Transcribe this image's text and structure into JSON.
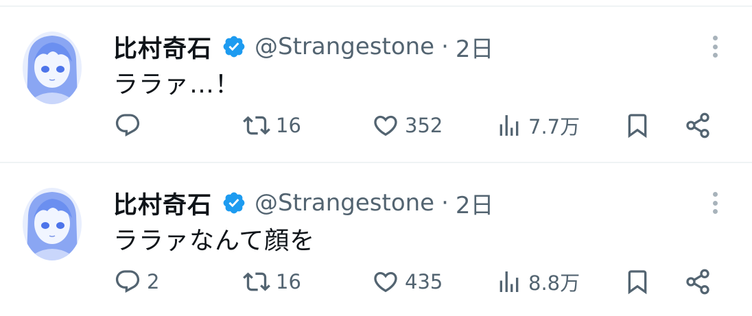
{
  "tweets": [
    {
      "name": "比村奇石",
      "handle": "@Strangestone",
      "separator": "·",
      "time": "2日",
      "text": "ララァ…！",
      "replies": "",
      "retweets": "16",
      "likes": "352",
      "views": "7.7万"
    },
    {
      "name": "比村奇石",
      "handle": "@Strangestone",
      "separator": "·",
      "time": "2日",
      "text": "ララァなんて顔を",
      "replies": "2",
      "retweets": "16",
      "likes": "435",
      "views": "8.8万"
    }
  ],
  "colors": {
    "text": "#0f1419",
    "muted": "#536471",
    "verified": "#1d9bf0",
    "divider": "#eff3f4",
    "avatar_tint": "#6b8ff0"
  },
  "icons": [
    "verified-badge-icon",
    "more-options-icon",
    "reply-icon",
    "retweet-icon",
    "like-icon",
    "views-icon",
    "bookmark-icon",
    "share-icon"
  ]
}
